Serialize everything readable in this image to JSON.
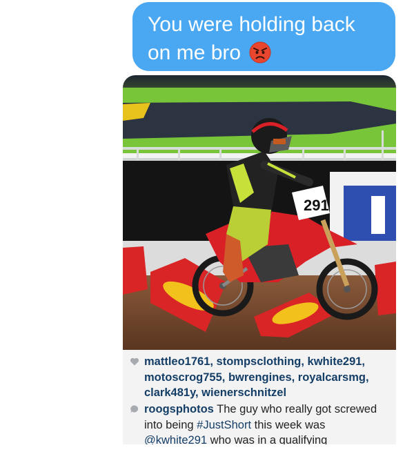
{
  "message": {
    "text": "You were holding back",
    "text_line2": "on me bro",
    "emoji": "angry-face-icon",
    "bubble_color": "#4aa8f2"
  },
  "post": {
    "rider_number": "291",
    "likes": {
      "icon": "heart-icon",
      "users": "mattleo1761, stompsclothing, kwhite291, motoscrog755, bwrengines, royalcarsmg, clark481y, wienerschnitzel"
    },
    "comment": {
      "icon": "comment-bubble-icon",
      "user": "roogsphotos",
      "text_before": "The guy who really got screwed into being",
      "hashtag": "#JustShort",
      "text_mid": "this week was",
      "mention": "@kwhite291",
      "text_after": "who was in a qualifying"
    }
  }
}
